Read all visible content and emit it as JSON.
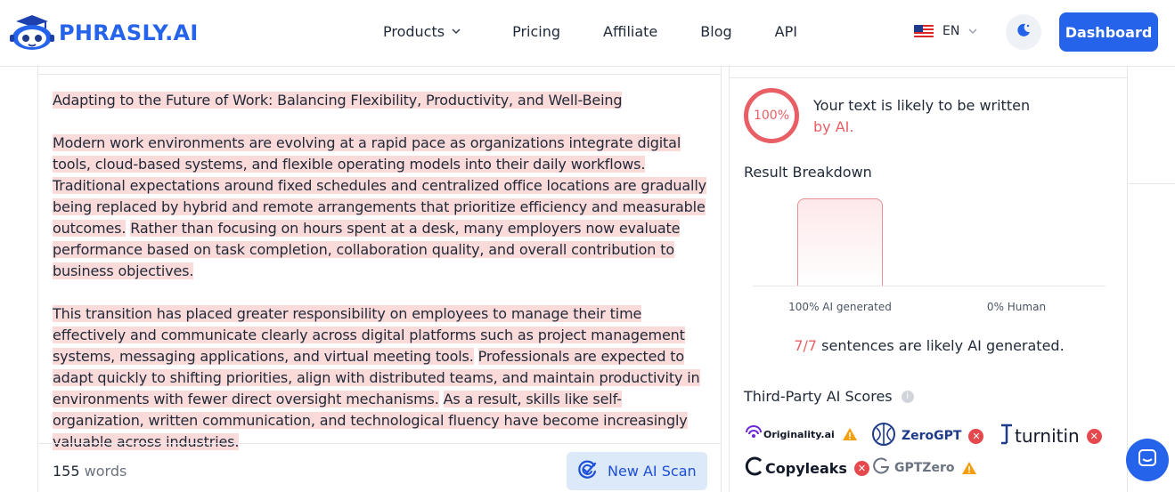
{
  "header": {
    "brand": "PHRASLY.AI",
    "nav": [
      {
        "label": "Products",
        "has_dropdown": true
      },
      {
        "label": "Pricing"
      },
      {
        "label": "Affiliate"
      },
      {
        "label": "Blog"
      },
      {
        "label": "API"
      }
    ],
    "language": "EN",
    "theme_icon": "moon-icon",
    "dashboard_label": "Dashboard"
  },
  "editor": {
    "paragraphs": [
      [
        "Adapting to the Future of Work: Balancing Flexibility, Productivity, and Well-Being"
      ],
      [
        "Modern work environments are evolving at a rapid pace as organizations integrate digital tools, cloud-based systems, and flexible operating models into their daily workflows.",
        "Traditional expectations around fixed schedules and centralized office locations are gradually being replaced by hybrid and remote arrangements that prioritize efficiency and measurable outcomes.",
        "Rather than focusing on hours spent at a desk, many employers now evaluate performance based on task completion, collaboration quality, and overall contribution to business objectives."
      ],
      [
        "This transition has placed greater responsibility on employees to manage their time effectively and communicate clearly across digital platforms such as project management systems, messaging applications, and virtual meeting tools.",
        "Professionals are expected to adapt quickly to shifting priorities, align with distributed teams, and maintain productivity in environments with fewer direct oversight mechanisms.",
        "As a result, skills like self-organization, written communication, and technological fluency have become increasingly valuable across industries."
      ]
    ],
    "word_count": "155",
    "word_label": "words",
    "scan_button": "New AI Scan"
  },
  "result": {
    "score": "100%",
    "verdict_line1": "Your text is likely to be written",
    "verdict_line2": "by AI.",
    "breakdown_title": "Result Breakdown",
    "sentences_count": "7/7",
    "sentences_mid": " sentences are likely ",
    "sentences_end": "AI generated.",
    "third_party_title": "Third-Party AI Scores",
    "third_party": [
      {
        "name": "Originality.ai",
        "status": "warning"
      },
      {
        "name": "ZeroGPT",
        "status": "error"
      },
      {
        "name": "turnitin",
        "status": "error"
      },
      {
        "name": "Copyleaks",
        "status": "error"
      },
      {
        "name": "GPTZero",
        "status": "warning"
      }
    ],
    "colors": {
      "ai": "#e85f66",
      "accent": "#2563eb",
      "error": "#e5484d",
      "warning": "#f59e0b"
    }
  },
  "chart_data": {
    "type": "bar",
    "categories": [
      "100% AI generated",
      "0% Human"
    ],
    "values": [
      100,
      0
    ],
    "ylim": [
      0,
      100
    ],
    "grid": false
  }
}
